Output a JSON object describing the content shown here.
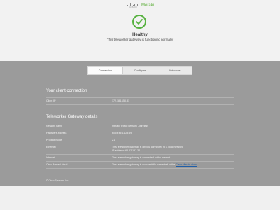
{
  "header": {
    "cisco_text": "CISCO",
    "meraki_text": "Meraki"
  },
  "status": {
    "title": "Healthy",
    "subtitle": "This teleworker gateway is functioning normally",
    "color": "#57b240"
  },
  "tabs": [
    {
      "label": "Connection",
      "active": true
    },
    {
      "label": "Configure",
      "active": false
    },
    {
      "label": "Antennas",
      "active": false
    }
  ],
  "client_connection": {
    "title": "Your client connection",
    "rows": [
      {
        "key": "Client IP",
        "value": "172.184.150.81"
      }
    ]
  },
  "gateway_details": {
    "title": "Teleworker Gateway details",
    "rows": [
      {
        "key": "Network name",
        "value": "meraki_teleco network - wireless"
      },
      {
        "key": "Hardware address",
        "value": "e0:cb:bc:11:23:59"
      },
      {
        "key": "Product model",
        "value": "Z1"
      },
      {
        "key": "Ethernet",
        "value": "This teleworker gateway is directly connected to a local network.",
        "value2": "IP address: 66.62.157.32"
      },
      {
        "key": "Internet",
        "value": "This teleworker gateway is connected to the Internet."
      },
      {
        "key": "Cisco Meraki cloud",
        "value": "This teleworker gateway is successfully connected to the",
        "link": "Cisco Meraki cloud"
      }
    ]
  },
  "footer": {
    "copyright": "© Cisco Systems, Inc."
  }
}
